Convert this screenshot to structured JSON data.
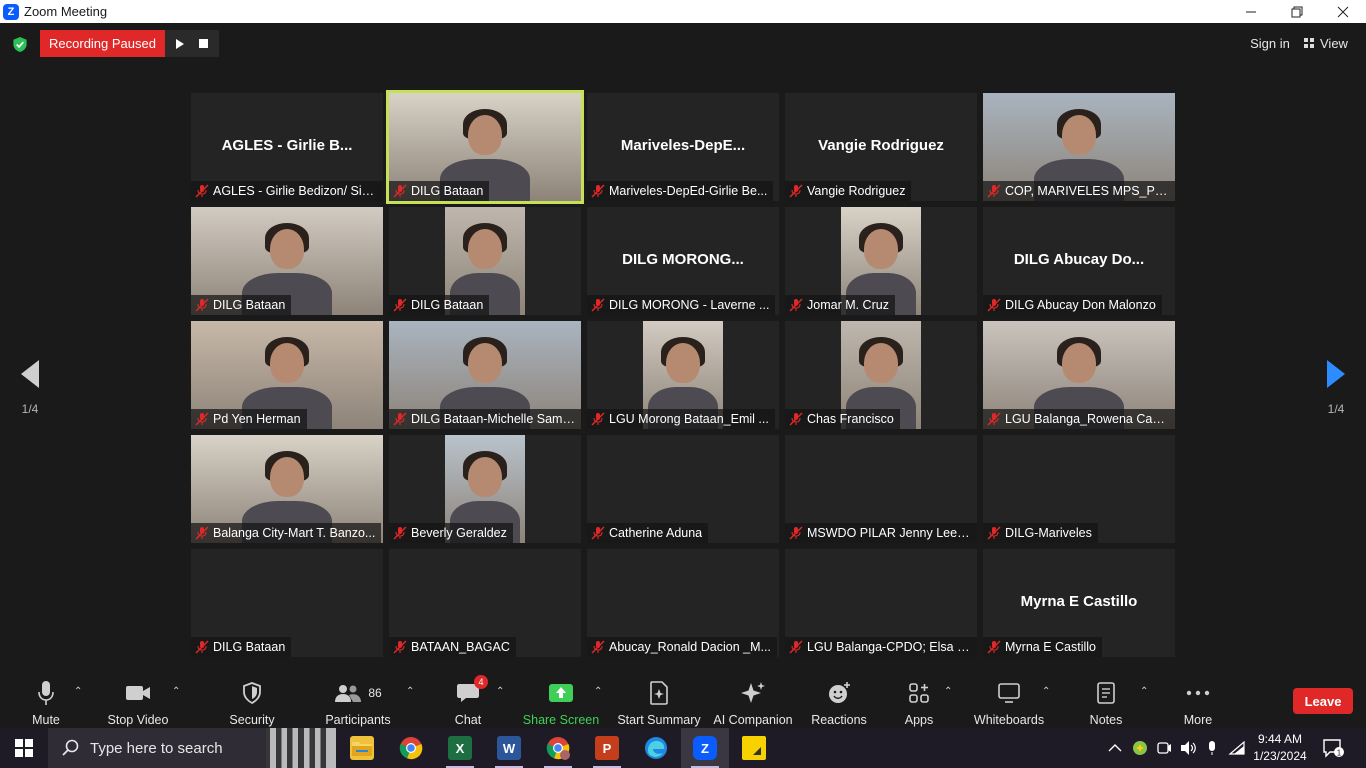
{
  "window": {
    "title": "Zoom Meeting",
    "app_icon_letter": "Z"
  },
  "topbar": {
    "recording_status": "Recording Paused",
    "sign_in": "Sign in",
    "view": "View"
  },
  "gallery": {
    "page_indicator_left": "1/4",
    "page_indicator_right": "1/4",
    "tiles": [
      {
        "name": "AGLES - Girlie Bedizon/ Sir ...",
        "big_name": "AGLES - Girlie B...",
        "has_video": false,
        "speaking": false
      },
      {
        "name": "DILG Bataan",
        "big_name": "",
        "has_video": true,
        "speaking": true
      },
      {
        "name": "Mariveles-DepEd-Girlie Be...",
        "big_name": "Mariveles-DepE...",
        "has_video": false,
        "speaking": false
      },
      {
        "name": "Vangie Rodriguez",
        "big_name": "Vangie Rodriguez",
        "has_video": false,
        "speaking": false
      },
      {
        "name": "COP, MARIVELES MPS_PLT...",
        "big_name": "",
        "has_video": true,
        "speaking": false
      },
      {
        "name": "DILG Bataan",
        "big_name": "",
        "has_video": true,
        "speaking": false
      },
      {
        "name": "DILG Bataan",
        "big_name": "",
        "has_video": true,
        "speaking": false
      },
      {
        "name": "DILG MORONG - Laverne ...",
        "big_name": "DILG  MORONG...",
        "has_video": false,
        "speaking": false
      },
      {
        "name": "Jomar M. Cruz",
        "big_name": "",
        "has_video": true,
        "speaking": false
      },
      {
        "name": "DILG Abucay Don Malonzo",
        "big_name": "DILG  Abucay  Do...",
        "has_video": false,
        "speaking": false
      },
      {
        "name": "Pd  Yen Herman",
        "big_name": "",
        "has_video": true,
        "speaking": false
      },
      {
        "name": "DILG Bataan-Michelle Sams...",
        "big_name": "",
        "has_video": true,
        "speaking": false
      },
      {
        "name": "LGU Morong Bataan_Emil ...",
        "big_name": "",
        "has_video": true,
        "speaking": false
      },
      {
        "name": "Chas Francisco",
        "big_name": "",
        "has_video": true,
        "speaking": false
      },
      {
        "name": "LGU Balanga_Rowena Cabr...",
        "big_name": "",
        "has_video": true,
        "speaking": false
      },
      {
        "name": "Balanga City-Mart T. Banzo...",
        "big_name": "",
        "has_video": true,
        "speaking": false
      },
      {
        "name": "Beverly Geraldez",
        "big_name": "",
        "has_video": true,
        "speaking": false
      },
      {
        "name": "Catherine Aduna",
        "big_name": "",
        "has_video": false,
        "speaking": false
      },
      {
        "name": "MSWDO PILAR Jenny Lee C...",
        "big_name": "",
        "has_video": false,
        "speaking": false
      },
      {
        "name": "DILG-Mariveles",
        "big_name": "",
        "has_video": false,
        "speaking": false
      },
      {
        "name": "DILG Bataan",
        "big_name": "",
        "has_video": false,
        "speaking": false
      },
      {
        "name": "BATAAN_BAGAC",
        "big_name": "",
        "has_video": false,
        "speaking": false
      },
      {
        "name": "Abucay_Ronald Dacion _M...",
        "big_name": "",
        "has_video": false,
        "speaking": false
      },
      {
        "name": "LGU Balanga-CPDO; Elsa Il...",
        "big_name": "",
        "has_video": false,
        "speaking": false
      },
      {
        "name": "Myrna E Castillo",
        "big_name": "Myrna E Castillo",
        "has_video": false,
        "speaking": false
      }
    ]
  },
  "toolbar": {
    "mute": "Mute",
    "stop_video": "Stop Video",
    "security": "Security",
    "participants": "Participants",
    "participants_count": "86",
    "chat": "Chat",
    "chat_badge": "4",
    "share_screen": "Share Screen",
    "start_summary": "Start Summary",
    "ai_companion": "AI Companion",
    "reactions": "Reactions",
    "apps": "Apps",
    "whiteboards": "Whiteboards",
    "notes": "Notes",
    "more": "More",
    "leave": "Leave"
  },
  "taskbar": {
    "search_placeholder": "Type here to search",
    "time": "9:44 AM",
    "date": "1/23/2024",
    "notification_count": "1",
    "apps": [
      "file-explorer",
      "chrome",
      "excel",
      "word",
      "chrome-profile",
      "powerpoint",
      "edge",
      "zoom",
      "sticky-notes"
    ]
  },
  "colors": {
    "recording_red": "#e02828",
    "share_green": "#3fcf59",
    "speaker_outline": "#c7e05a",
    "nav_blue": "#2d8cff"
  }
}
